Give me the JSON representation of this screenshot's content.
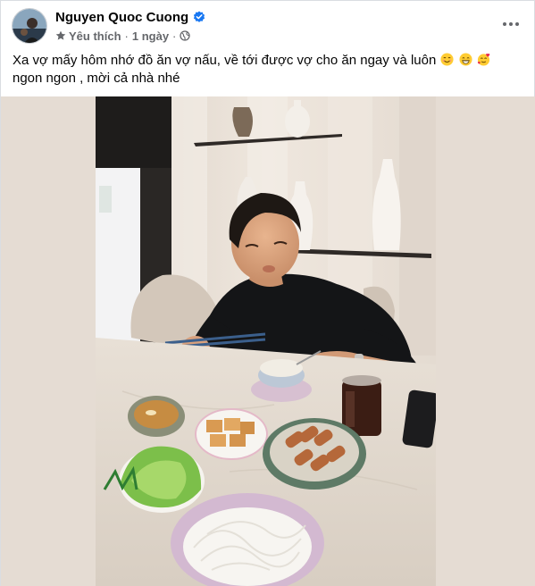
{
  "post": {
    "author": "Nguyen Quoc Cuong",
    "follow_label": "Yêu thích",
    "separator": "·",
    "timestamp": "1 ngày",
    "text": "Xa vợ mấy hôm nhớ đồ ăn vợ nấu, về tới được vợ cho ăn ngay và luôn",
    "text_end": "ngon ngon , mời cả nhà nhé",
    "emojis": [
      "smiling-face-icon",
      "grinning-face-icon",
      "face-with-hearts-icon"
    ]
  },
  "icons": {
    "verified": "verified-badge-icon",
    "favorite": "star-icon",
    "audience": "globe-icon",
    "more": "more-options-icon"
  },
  "colors": {
    "verified_blue": "#1877f2",
    "secondary_text": "#65676b",
    "photo_background": "#e5dcd3"
  }
}
